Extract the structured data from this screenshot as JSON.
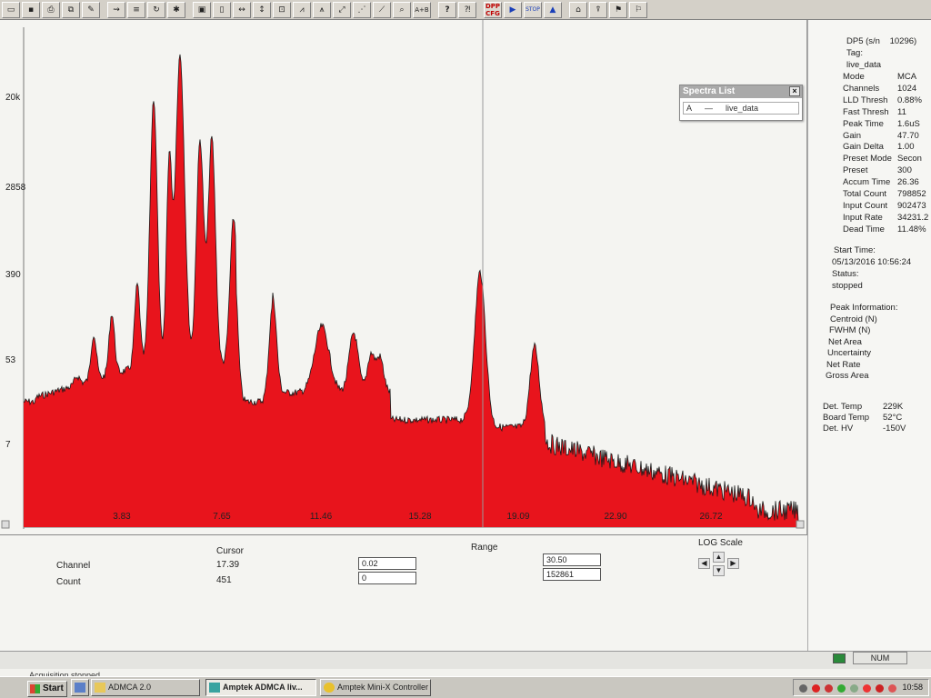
{
  "toolbar": {
    "buttons": [
      "open",
      "save",
      "print",
      "copy",
      "edit",
      "peak",
      "calibrate",
      "settings",
      "roi",
      "page",
      "left-right",
      "up-down",
      "zoom",
      "spectrum",
      "region",
      "scale",
      "line",
      "fit",
      "search",
      "add"
    ],
    "add_label": "A+B",
    "help_label": "?",
    "dpp_label": "DPP CFG",
    "stop_label": "STOP",
    "accent_color": "#c00000"
  },
  "plot": {
    "fill_color": "#e8141c",
    "outline_color": "#1a1a1a",
    "y_labels": [
      "20k",
      "2858",
      "390",
      "53",
      "7"
    ],
    "x_labels": [
      "3.83",
      "7.65",
      "11.46",
      "15.28",
      "19.09",
      "22.90",
      "26.72"
    ],
    "cursor_channel": 17.39
  },
  "spectra_list": {
    "title": "Spectra List",
    "close": "×",
    "entry_id": "A",
    "entry_line": "—",
    "entry_name": "live_data"
  },
  "info": {
    "device": "DP5 (s/n",
    "serial": "10296)",
    "tag_label": "Tag:",
    "tag_value": "live_data",
    "params": [
      {
        "k": "Mode",
        "v": "MCA"
      },
      {
        "k": "Channels",
        "v": "1024"
      },
      {
        "k": "LLD Thresh",
        "v": "0.88%"
      },
      {
        "k": "Fast Thresh",
        "v": "11"
      },
      {
        "k": "Peak Time",
        "v": "1.6uS"
      },
      {
        "k": "Gain",
        "v": "47.70"
      },
      {
        "k": "Gain Delta",
        "v": "1.00"
      },
      {
        "k": "Preset Mode",
        "v": "Secon"
      },
      {
        "k": "Preset",
        "v": "300"
      },
      {
        "k": "Accum Time",
        "v": "26.36"
      },
      {
        "k": "Total Count",
        "v": "798852"
      },
      {
        "k": "Input Count",
        "v": "902473"
      },
      {
        "k": "Input Rate",
        "v": "34231.2"
      },
      {
        "k": "Dead Time",
        "v": "11.48%"
      }
    ],
    "start_time_label": "Start Time:",
    "start_time_value": "05/13/2016 10:56:24",
    "status_label": "Status:",
    "status_value": "stopped",
    "peak_info_label": "Peak Information:",
    "peak_items": [
      "Centroid (N)",
      "FWHM (N)",
      "Net Area",
      "Uncertainty",
      "Net Rate",
      "Gross Area"
    ],
    "temps": [
      {
        "k": "Det. Temp",
        "v": "229K"
      },
      {
        "k": "Board Temp",
        "v": "52°C"
      },
      {
        "k": "Det. HV",
        "v": "-150V"
      }
    ]
  },
  "bottom": {
    "cursor_label": "Cursor",
    "range_label": "Range",
    "log_label": "LOG Scale",
    "channel_label": "Channel",
    "count_label": "Count",
    "cursor_channel": "17.39",
    "cursor_count": "451",
    "range_ch_min": "0.02",
    "range_ch_max": "30.50",
    "range_cnt_min": "0",
    "range_cnt_max": "152861"
  },
  "status": {
    "text": "Acquisition stopped...",
    "num": "NUM"
  },
  "taskbar": {
    "start": "Start",
    "tasks": [
      "ADMCA 2.0",
      "Amptek ADMCA   liv...",
      "Amptek Mini-X Controller"
    ],
    "clock": "10:58"
  }
}
